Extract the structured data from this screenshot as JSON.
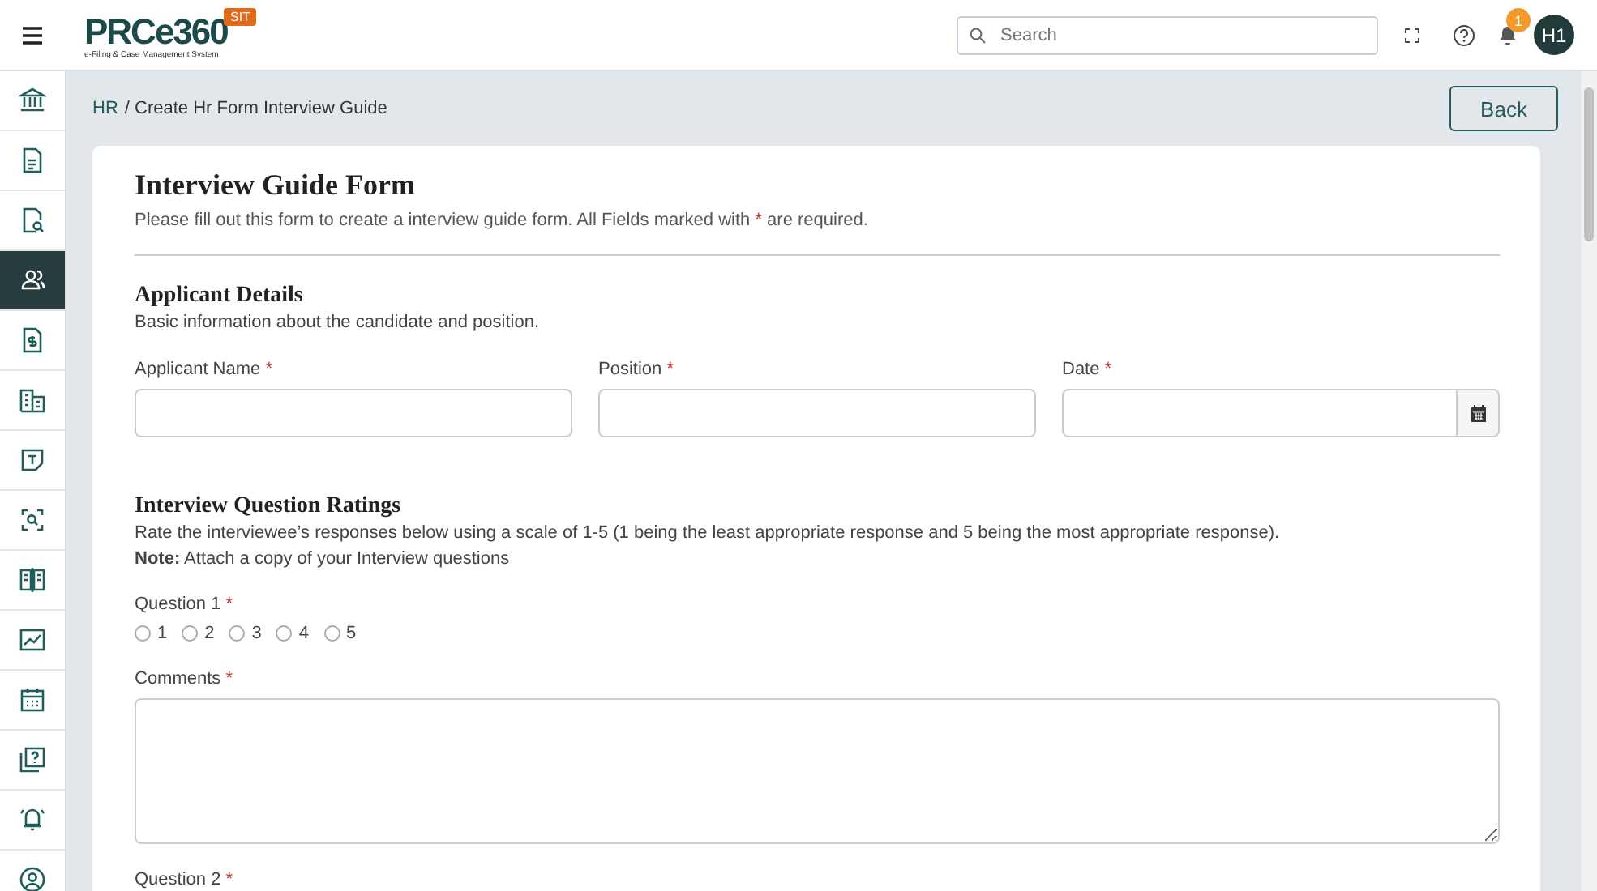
{
  "header": {
    "logo": "PRCe360",
    "logo_tagline": "e-Filing & Case Management System",
    "env_badge": "SIT",
    "search": {
      "placeholder": "Search"
    },
    "notification_count": "1",
    "avatar": "H1"
  },
  "sidebar": {
    "items": [
      {
        "selected": false
      },
      {
        "selected": false
      },
      {
        "selected": false
      },
      {
        "selected": true
      },
      {
        "selected": false
      },
      {
        "selected": false
      },
      {
        "selected": false
      },
      {
        "selected": false
      },
      {
        "selected": false
      },
      {
        "selected": false
      },
      {
        "selected": false
      },
      {
        "selected": false
      },
      {
        "selected": false
      },
      {
        "selected": false
      }
    ]
  },
  "breadcrumb": {
    "root": "HR",
    "current": "/ Create Hr Form Interview Guide"
  },
  "back_button": "Back",
  "form": {
    "title": "Interview Guide Form",
    "intro": [
      "Please fill out this form to create a interview guide form. All Fields marked with",
      "*",
      "are required."
    ],
    "sections": [
      {
        "title": "Applicant Details",
        "description": "Basic information about the candidate and position.",
        "fields": [
          {
            "kind": "text",
            "label": "Applicant Name",
            "required_mark": "*"
          },
          {
            "kind": "text",
            "label": "Position",
            "required_mark": "*"
          },
          {
            "kind": "date",
            "label": "Date",
            "required_mark": "*"
          }
        ]
      },
      {
        "title": "Interview Question Ratings",
        "description": "Rate the interviewee’s responses below using a scale of 1-5 (1 being the least appropriate response and 5 being the most appropriate response).",
        "note": "**Note:** Attach a copy of your Interview questions",
        "fields": [
          {
            "kind": "rating",
            "label": "Question 1",
            "required_mark": "*",
            "options": [
              {
                "label": "1",
                "selected": false
              },
              {
                "label": "2",
                "selected": false
              },
              {
                "label": "3",
                "selected": false
              },
              {
                "label": "4",
                "selected": false
              },
              {
                "label": "5",
                "selected": false
              }
            ]
          },
          {
            "kind": "textarea",
            "label": "Comments",
            "required_mark": "*"
          },
          {
            "kind": "rating",
            "label": "Question 2",
            "required_mark": "*"
          }
        ]
      }
    ]
  }
}
